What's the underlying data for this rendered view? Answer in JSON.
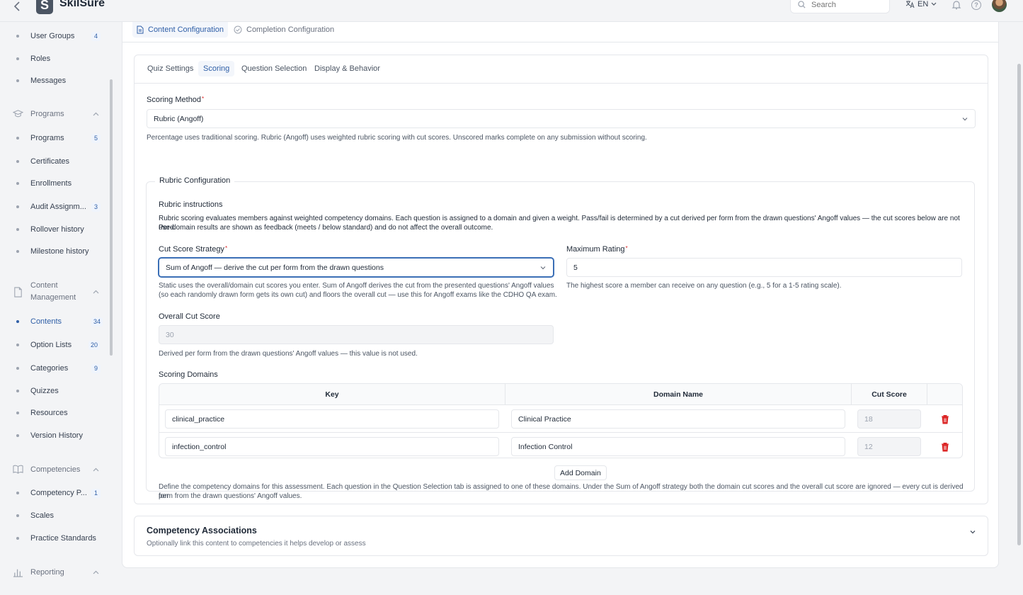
{
  "app": {
    "name": "SkilSure",
    "logo_letter": "S"
  },
  "header": {
    "search_placeholder": "Search",
    "language": "EN"
  },
  "sidebar": {
    "items": [
      {
        "label": "User Groups",
        "badge": "4"
      },
      {
        "label": "Roles",
        "badge": ""
      },
      {
        "label": "Messages",
        "badge": ""
      },
      {
        "section": "Programs"
      },
      {
        "label": "Programs",
        "badge": "5"
      },
      {
        "label": "Certificates",
        "badge": ""
      },
      {
        "label": "Enrollments",
        "badge": ""
      },
      {
        "label": "Audit Assignm...",
        "badge": "3"
      },
      {
        "label": "Rollover history",
        "badge": ""
      },
      {
        "label": "Milestone history",
        "badge": ""
      },
      {
        "section": "Content Management"
      },
      {
        "label": "Contents",
        "badge": "34",
        "active": true
      },
      {
        "label": "Option Lists",
        "badge": "20"
      },
      {
        "label": "Categories",
        "badge": "9"
      },
      {
        "label": "Quizzes",
        "badge": ""
      },
      {
        "label": "Resources",
        "badge": ""
      },
      {
        "label": "Version History",
        "badge": ""
      },
      {
        "section": "Competencies"
      },
      {
        "label": "Competency P...",
        "badge": "1"
      },
      {
        "label": "Scales",
        "badge": ""
      },
      {
        "label": "Practice Standards",
        "badge": ""
      },
      {
        "section": "Reporting"
      }
    ],
    "labels": {
      "user_groups": "User Groups",
      "user_groups_badge": "4",
      "roles": "Roles",
      "messages": "Messages",
      "programs_section": "Programs",
      "programs": "Programs",
      "programs_badge": "5",
      "certificates": "Certificates",
      "enrollments": "Enrollments",
      "audit": "Audit Assignm...",
      "audit_badge": "3",
      "rollover": "Rollover history",
      "milestone": "Milestone history",
      "content_section_1": "Content",
      "content_section_2": "Management",
      "contents": "Contents",
      "contents_badge": "34",
      "option_lists": "Option Lists",
      "option_lists_badge": "20",
      "categories": "Categories",
      "categories_badge": "9",
      "quizzes": "Quizzes",
      "resources": "Resources",
      "version_history": "Version History",
      "competencies_section": "Competencies",
      "competency_p": "Competency P...",
      "competency_p_badge": "1",
      "scales": "Scales",
      "practice_standards": "Practice Standards",
      "reporting_section": "Reporting"
    }
  },
  "top_tabs": {
    "content_config": "Content Configuration",
    "completion_config": "Completion Configuration"
  },
  "sub_tabs": {
    "quiz_settings": "Quiz Settings",
    "scoring": "Scoring",
    "question_selection": "Question Selection",
    "display_behavior": "Display & Behavior"
  },
  "scoring": {
    "method_label": "Scoring Method",
    "method_value": "Rubric (Angoff)",
    "method_help": "Percentage uses traditional scoring. Rubric (Angoff) uses weighted rubric scoring with cut scores. Unscored marks complete on any submission without scoring."
  },
  "rubric": {
    "legend": "Rubric Configuration",
    "instructions_title": "Rubric instructions",
    "instructions_line1": "Rubric scoring evaluates members against weighted competency domains. Each question is assigned to a domain and given a weight. Pass/fail is determined by a cut derived per form from the drawn questions' Angoff values — the cut scores below are not used.",
    "instructions_line2": "Per-domain results are shown as feedback (meets / below standard) and do not affect the overall outcome.",
    "cut_strategy_label": "Cut Score Strategy",
    "cut_strategy_value": "Sum of Angoff — derive the cut per form from the drawn questions",
    "cut_strategy_help_line1": "Static uses the overall/domain cut scores you enter. Sum of Angoff derives the cut from the presented questions' Angoff values",
    "cut_strategy_help_line2": "(so each randomly drawn form gets its own cut) and floors the overall cut — use this for Angoff exams like the CDHO QA exam.",
    "max_rating_label": "Maximum Rating",
    "max_rating_value": "5",
    "max_rating_help": "The highest score a member can receive on any question (e.g., 5 for a 1-5 rating scale).",
    "overall_cut_label": "Overall Cut Score",
    "overall_cut_value": "30",
    "overall_cut_help": "Derived per form from the drawn questions' Angoff values — this value is not used.",
    "domains_label": "Scoring Domains",
    "columns": {
      "key": "Key",
      "name": "Domain Name",
      "cut": "Cut Score"
    },
    "domains": [
      {
        "key": "clinical_practice",
        "name": "Clinical Practice",
        "cut": "18"
      },
      {
        "key": "infection_control",
        "name": "Infection Control",
        "cut": "12"
      }
    ],
    "add_domain": "Add Domain",
    "domains_help_line1": "Define the competency domains for this assessment. Each question in the Question Selection tab is assigned to one of these domains. Under the Sum of Angoff strategy both the domain cut scores and the overall cut score are ignored — every cut is derived per",
    "domains_help_line2": "form from the drawn questions' Angoff values."
  },
  "competency": {
    "title": "Competency Associations",
    "subtitle": "Optionally link this content to competencies it helps develop or assess"
  },
  "colors": {
    "accent": "#2f5fa7",
    "danger": "#dc2626",
    "border": "#e5e7eb"
  }
}
